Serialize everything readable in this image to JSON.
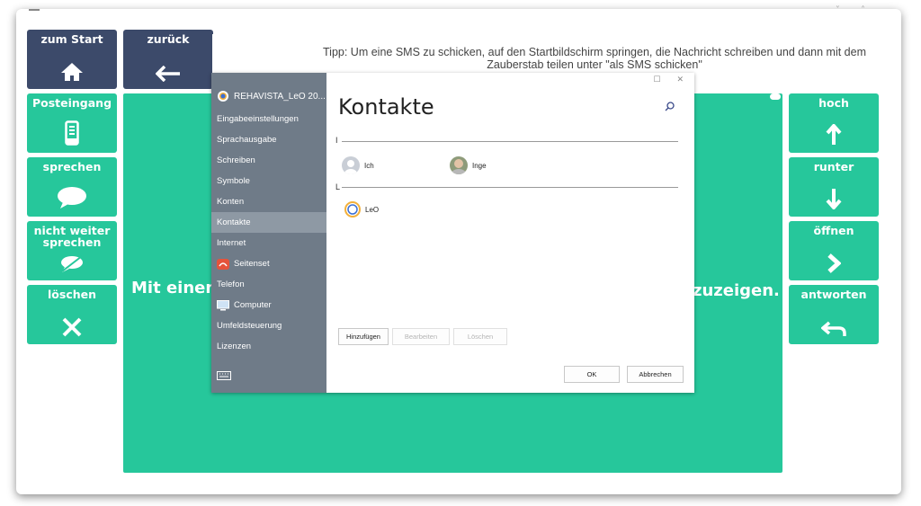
{
  "topbar": {
    "tip": "Tipp: Um eine SMS zu schicken, auf den Startbildschirm springen, die Nachricht schreiben und dann mit dem Zauberstab teilen unter \"als SMS schicken\""
  },
  "left_tiles": [
    {
      "label": "zum Start",
      "icon": "home-icon"
    },
    {
      "label": "zurück",
      "icon": "arrow-left-icon"
    },
    {
      "label": "Posteingang",
      "icon": "phone-icon"
    },
    {
      "label": "sprechen",
      "icon": "speech-bubble-icon"
    },
    {
      "label": "nicht weiter sprechen",
      "icon": "mute-bubble-icon"
    },
    {
      "label": "löschen",
      "icon": "close-icon"
    }
  ],
  "right_tiles": [
    {
      "label": "hoch",
      "icon": "arrow-up-icon"
    },
    {
      "label": "runter",
      "icon": "arrow-down-icon"
    },
    {
      "label": "öffnen",
      "icon": "chevron-right-icon"
    },
    {
      "label": "antworten",
      "icon": "reply-icon"
    }
  ],
  "main": {
    "text_left": "Mit einem",
    "text_right": "zuzeigen."
  },
  "dialog": {
    "title": "REHAVISTA_LeO 20...",
    "nav_items": [
      "Eingabeeinstellungen",
      "Sprachausgabe",
      "Schreiben",
      "Symbole",
      "Konten",
      "Kontakte",
      "Internet",
      "Seitenset",
      "Telefon",
      "Computer",
      "Umfeldsteuerung",
      "Lizenzen"
    ],
    "selected_nav": "Kontakte",
    "heading": "Kontakte",
    "groups": [
      {
        "letter": "I",
        "contacts": [
          "Ich",
          "Inge"
        ]
      },
      {
        "letter": "L",
        "contacts": [
          "LeO"
        ]
      }
    ],
    "buttons": {
      "add": "Hinzufügen",
      "edit": "Bearbeiten",
      "delete": "Löschen",
      "ok": "OK",
      "cancel": "Abbrechen"
    },
    "window_controls": {
      "maximize": "☐",
      "close": "✕"
    }
  },
  "colors": {
    "dark_tile": "#3c4a6a",
    "green_tile": "#26c79b",
    "nav_bg": "#6f7b88",
    "nav_selected": "#8e99a4",
    "seitenset_icon": "#e5533b"
  }
}
